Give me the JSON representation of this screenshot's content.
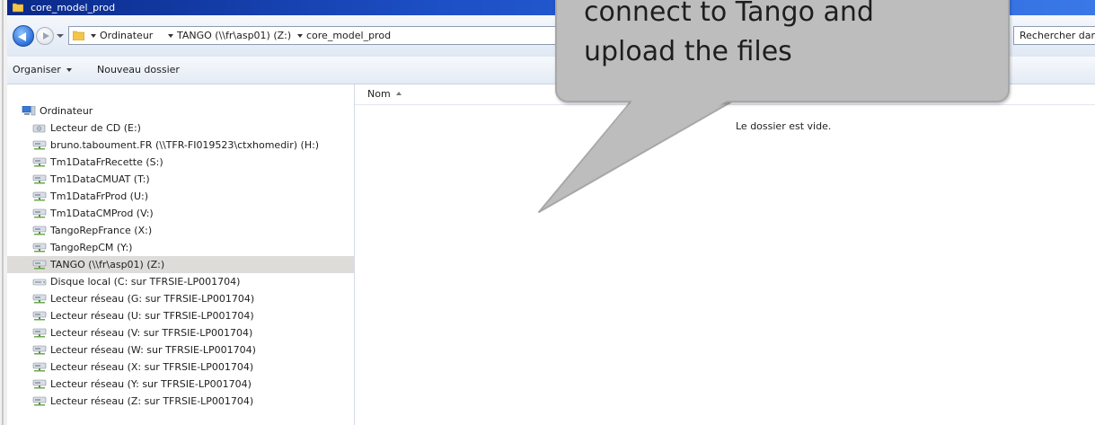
{
  "window": {
    "title": "core_model_prod"
  },
  "address": {
    "crumbs": [
      "Ordinateur",
      "TANGO (\\\\fr\\asp01) (Z:)",
      "core_model_prod"
    ],
    "search_placeholder": "Rechercher dans :"
  },
  "toolbar": {
    "organize_label": "Organiser",
    "new_folder_label": "Nouveau dossier"
  },
  "nav": {
    "root_label": "Ordinateur",
    "items": [
      {
        "label": "Lecteur de CD (E:)",
        "icon": "cd-drive-icon"
      },
      {
        "label": "bruno.taboument.FR (\\\\TFR-FI019523\\ctxhomedir) (H:)",
        "icon": "network-drive-icon"
      },
      {
        "label": "Tm1DataFrRecette (S:)",
        "icon": "network-drive-icon"
      },
      {
        "label": "Tm1DataCMUAT (T:)",
        "icon": "network-drive-icon"
      },
      {
        "label": "Tm1DataFrProd (U:)",
        "icon": "network-drive-icon"
      },
      {
        "label": "Tm1DataCMProd (V:)",
        "icon": "network-drive-icon"
      },
      {
        "label": "TangoRepFrance (X:)",
        "icon": "network-drive-icon"
      },
      {
        "label": "TangoRepCM (Y:)",
        "icon": "network-drive-icon"
      },
      {
        "label": "TANGO (\\\\fr\\asp01) (Z:)",
        "icon": "network-drive-icon",
        "selected": true
      },
      {
        "label": "Disque local (C: sur TFRSIE-LP001704)",
        "icon": "local-disk-icon"
      },
      {
        "label": "Lecteur réseau (G: sur TFRSIE-LP001704)",
        "icon": "network-drive-icon"
      },
      {
        "label": "Lecteur réseau (U: sur TFRSIE-LP001704)",
        "icon": "network-drive-icon"
      },
      {
        "label": "Lecteur réseau (V: sur TFRSIE-LP001704)",
        "icon": "network-drive-icon"
      },
      {
        "label": "Lecteur réseau (W: sur TFRSIE-LP001704)",
        "icon": "network-drive-icon"
      },
      {
        "label": "Lecteur réseau (X: sur TFRSIE-LP001704)",
        "icon": "network-drive-icon"
      },
      {
        "label": "Lecteur réseau (Y: sur TFRSIE-LP001704)",
        "icon": "network-drive-icon"
      },
      {
        "label": "Lecteur réseau (Z: sur TFRSIE-LP001704)",
        "icon": "network-drive-icon"
      }
    ]
  },
  "content": {
    "column_name": "Nom",
    "empty_message": "Le dossier est vide."
  },
  "callout": {
    "line1": "connect to Tango and",
    "line2": "upload the files"
  }
}
